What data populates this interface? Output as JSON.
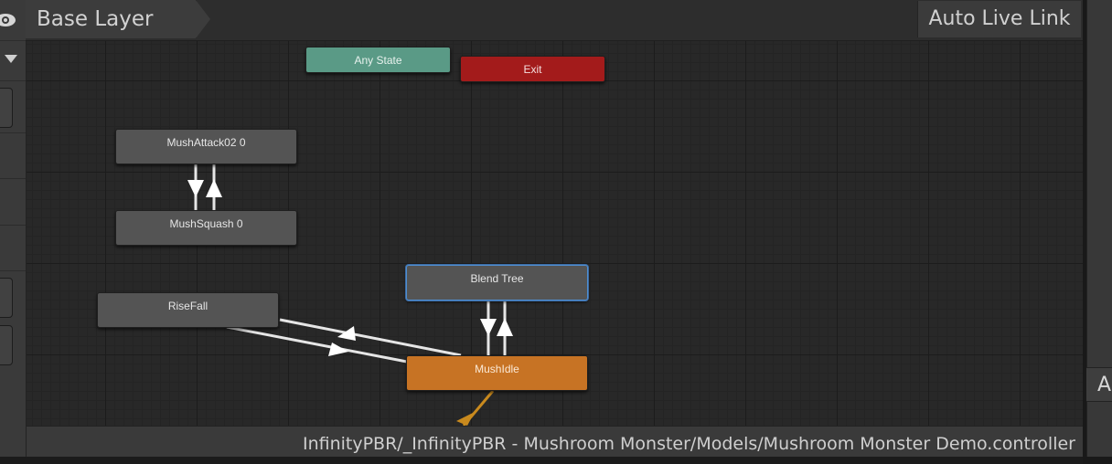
{
  "breadcrumb": {
    "layer": "Base Layer"
  },
  "toolbar": {
    "live_link": "Auto Live Link"
  },
  "graph": {
    "nodes": {
      "any_state": "Any State",
      "exit": "Exit",
      "mush_attack": "MushAttack02 0",
      "mush_squash": "MushSquash 0",
      "blend_tree": "Blend Tree",
      "rise_fall": "RiseFall",
      "mush_idle": "MushIdle"
    }
  },
  "footer": {
    "path": "InfinityPBR/_InfinityPBR - Mushroom Monster/Models/Mushroom Monster Demo.controller"
  },
  "right_panel": {
    "tab_letter": "A"
  },
  "colors": {
    "any_state": "#5a9a86",
    "exit": "#a31b1b",
    "default_state": "#c77324",
    "selected_outline": "#4f8ed1",
    "transition": "#e6e6e6",
    "entry_transition": "#c98a1e"
  },
  "icons": {
    "visibility": "eye-icon",
    "dropdown": "triangle-down-icon"
  }
}
